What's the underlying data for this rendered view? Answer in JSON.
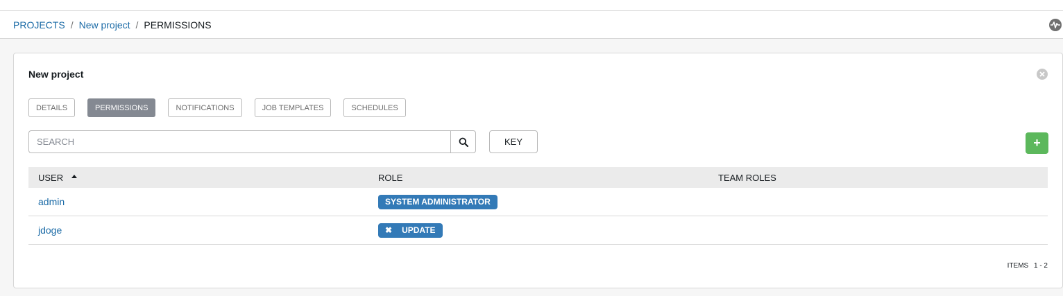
{
  "breadcrumb": {
    "items": [
      "PROJECTS",
      "New project"
    ],
    "separator": "/",
    "current": "PERMISSIONS"
  },
  "panel": {
    "title": "New project",
    "tabs": [
      {
        "label": "DETAILS",
        "active": false
      },
      {
        "label": "PERMISSIONS",
        "active": true
      },
      {
        "label": "NOTIFICATIONS",
        "active": false
      },
      {
        "label": "JOB TEMPLATES",
        "active": false
      },
      {
        "label": "SCHEDULES",
        "active": false
      }
    ],
    "search": {
      "placeholder": "SEARCH",
      "value": ""
    },
    "key_label": "KEY",
    "add_label": "+"
  },
  "table": {
    "columns": [
      "USER",
      "ROLE",
      "TEAM ROLES"
    ],
    "rows": [
      {
        "user": "admin",
        "role": "SYSTEM ADMINISTRATOR",
        "removable": false,
        "remove_glyph": "",
        "team_roles": ""
      },
      {
        "user": "jdoge",
        "role": "UPDATE",
        "removable": true,
        "remove_glyph": "✖",
        "team_roles": ""
      }
    ]
  },
  "pagination": {
    "label": "ITEMS",
    "range": "1 - 2"
  },
  "colors": {
    "link": "#1a6aa6",
    "badge": "#337ab7",
    "add_button": "#5cb85c",
    "active_tab": "#848992"
  }
}
